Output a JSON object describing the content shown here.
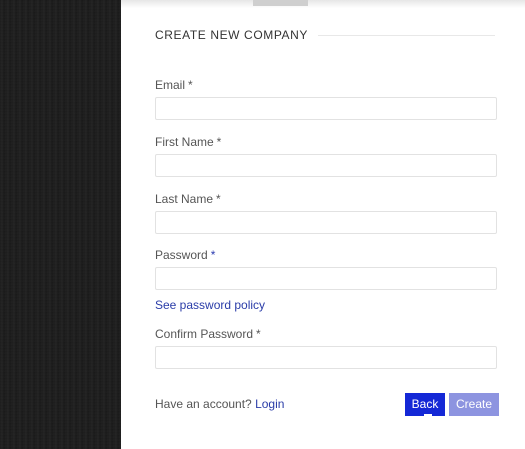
{
  "form": {
    "heading": "CREATE NEW COMPANY",
    "fields": [
      {
        "label": "Email",
        "required_mark": "*",
        "value": "",
        "placeholder": ""
      },
      {
        "label": "First Name",
        "required_mark": "*",
        "value": "",
        "placeholder": ""
      },
      {
        "label": "Last Name",
        "required_mark": "*",
        "value": "",
        "placeholder": ""
      },
      {
        "label": "Password",
        "required_mark": "*",
        "value": "",
        "placeholder": ""
      },
      {
        "label": "Confirm Password",
        "required_mark": "*",
        "value": "",
        "placeholder": ""
      }
    ],
    "password_policy_link": "See password policy",
    "have_account_text": "Have an account?",
    "login_link": "Login",
    "back_button": "Back",
    "create_button": "Create"
  },
  "colors": {
    "primary_button": "#1428d6",
    "disabled_button": "#8d94e0",
    "link": "#2a3ca8",
    "sidebar_background": "#1e1e1e"
  }
}
